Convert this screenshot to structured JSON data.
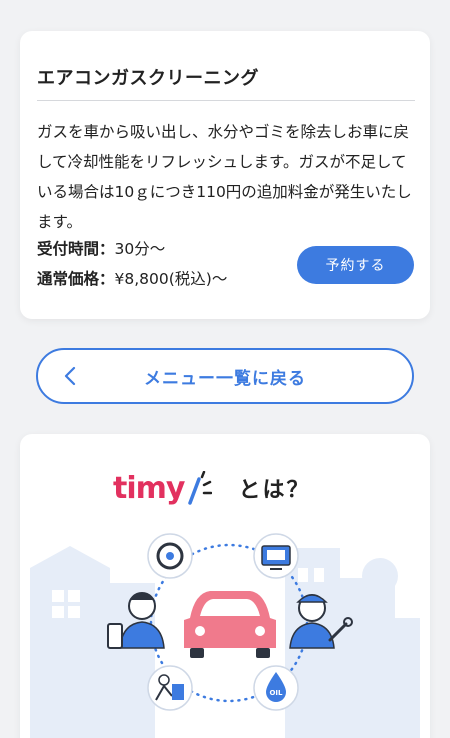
{
  "service": {
    "title": "エアコンガスクリーニング",
    "description": "ガスを車から吸い出し、水分やゴミを除去しお車に戻して冷却性能をリフレッシュします。ガスが不足している場合は10ｇにつき110円の追加料金が発生いたします。",
    "time_label": "受付時間：",
    "time_value": "30分～",
    "price_label": "通常価格：",
    "price_value": "¥8,800(税込)～",
    "reserve_label": "予約する"
  },
  "back_button": {
    "label": "メニュー一覧に戻る",
    "icon": "chevron-left-icon"
  },
  "about": {
    "logo": "timy",
    "suffix": "とは？"
  },
  "colors": {
    "accent": "#3d7be0",
    "brand": "#e2315f",
    "car": "#f07a8c",
    "background": "#f1f2f4"
  }
}
